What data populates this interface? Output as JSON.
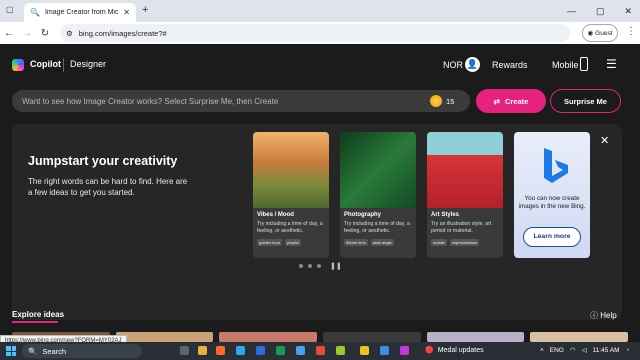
{
  "browser": {
    "tab_title": "Image Creator from Microsoft",
    "url": "bing.com/images/create?#",
    "guest_label": "Guest"
  },
  "header": {
    "brand": "Copilot",
    "section": "Designer",
    "user": "NOR",
    "rewards": "Rewards",
    "mobile": "Mobile"
  },
  "search": {
    "placeholder": "Want to see how Image Creator works? Select Surprise Me, then Create",
    "boosts": "15",
    "create_label": "Create",
    "surprise_label": "Surprise Me"
  },
  "promo": {
    "heading": "Jumpstart your creativity",
    "body": "The right words can be hard to find. Here are a few ideas to get you started.",
    "cards": [
      {
        "title": "Vibes / Mood",
        "desc": "Try including a time of day, a feeling, or aesthetic.",
        "tags": [
          "golden hour",
          "playful"
        ]
      },
      {
        "title": "Photography",
        "desc": "Try including a time of day, a feeling, or aesthetic.",
        "tags": [
          "85mm lens",
          "wide angle"
        ]
      },
      {
        "title": "Art Styles",
        "desc": "Try an illustration style, art period or material.",
        "tags": [
          "mobile",
          "impressionism"
        ]
      }
    ],
    "bing_text": "You can now create images in the new Bing.",
    "learn_more": "Learn more"
  },
  "explore": {
    "label": "Explore ideas",
    "help": "Help"
  },
  "status_url": "https://www.bing.com/new?FORM=MY02AJ",
  "taskbar": {
    "search": "Search",
    "notification": "Medal updates",
    "lang": "ENG",
    "time": "11:45 AM"
  },
  "colors": {
    "accent": "#e5227e",
    "page_bg": "#1b1b1b",
    "card_bg": "#3a3a3a"
  }
}
